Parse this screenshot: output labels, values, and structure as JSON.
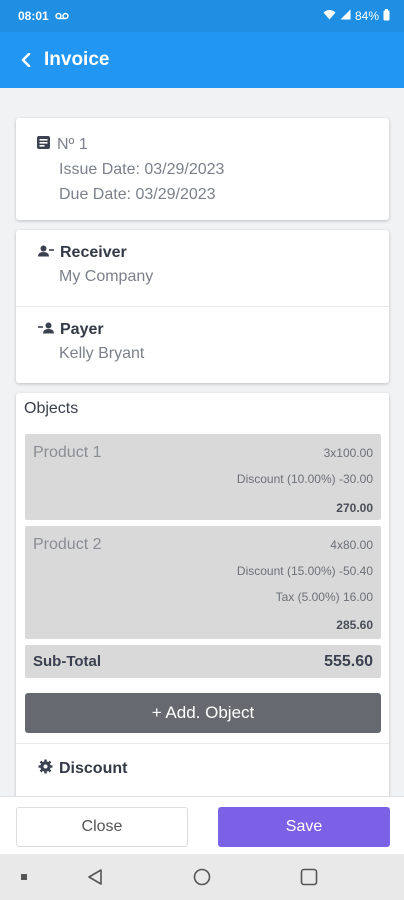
{
  "status": {
    "time": "08:01",
    "battery": "84%"
  },
  "appbar": {
    "title": "Invoice"
  },
  "invoice": {
    "number": "Nº 1",
    "issue_date": "Issue Date: 03/29/2023",
    "due_date": "Due Date: 03/29/2023"
  },
  "receiver": {
    "label": "Receiver",
    "value": "My Company"
  },
  "payer": {
    "label": "Payer",
    "value": "Kelly Bryant"
  },
  "objects": {
    "title": "Objects",
    "items": [
      {
        "name": "Product 1",
        "qty": "3x100.00",
        "discount": "Discount (10.00%) -30.00",
        "tax": "",
        "total": "270.00"
      },
      {
        "name": "Product 2",
        "qty": "4x80.00",
        "discount": "Discount (15.00%) -50.40",
        "tax": "Tax (5.00%) 16.00",
        "total": "285.60"
      }
    ],
    "subtotal_label": "Sub-Total",
    "subtotal_value": "555.60",
    "add_label": "+ Add. Object"
  },
  "discount": {
    "label": "Discount"
  },
  "footer": {
    "close_label": "Close",
    "save_label": "Save"
  },
  "colors": {
    "appbar": "#2196f3",
    "statusbar": "#1e8fe3",
    "save": "#7b61e6",
    "add_button": "#666a70",
    "product_bg": "#d9d9d9"
  },
  "icons": [
    "wifi-icon",
    "signal-icon",
    "battery-icon",
    "back-chevron-icon",
    "document-icon",
    "receiver-icon",
    "payer-icon",
    "discount-gear-icon",
    "nav-square-dot-icon",
    "nav-back-icon",
    "nav-home-icon",
    "nav-recents-icon"
  ]
}
